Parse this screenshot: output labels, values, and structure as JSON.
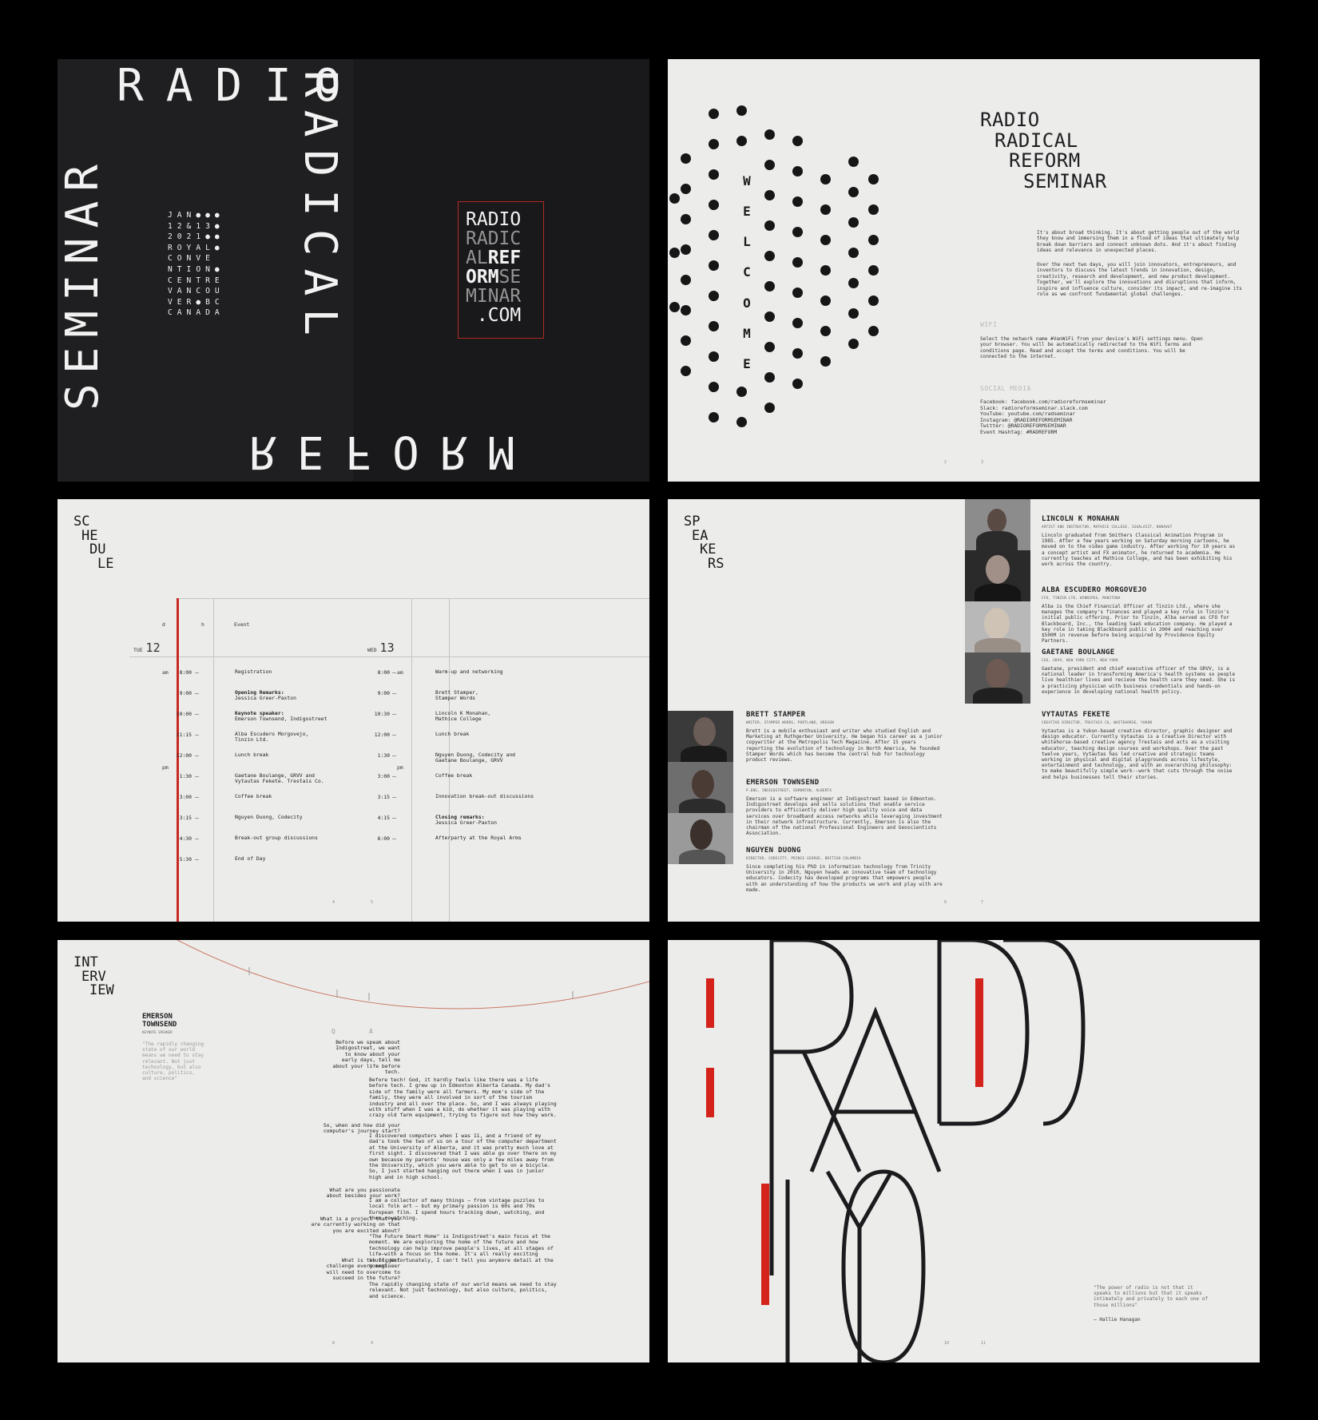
{
  "cover": {
    "radio": "RADIO",
    "radical": "RADICAL",
    "reform": "REFORM",
    "seminar": "SEMINAR",
    "event_grid": "JAN●●●\n12&13●\n2021●●\nROYAL●\nCONVE\nNTION●\nCENTRE\nVANCOU\nVER●BC\nCANADA",
    "url_lines": [
      {
        "text": "RADIO",
        "style": "normal"
      },
      {
        "text": "RADIC",
        "style": "thin"
      },
      {
        "text": "AL",
        "style": "thin",
        "rest": "REF",
        "rest_style": "bold"
      },
      {
        "text": "ORM",
        "style": "bold",
        "rest": "SE",
        "rest_style": "thin"
      },
      {
        "text": "MINAR",
        "style": "thin"
      },
      {
        "text": ".COM",
        "style": "normal"
      }
    ],
    "colors": {
      "background": "#19191b",
      "accent": "#b32a22"
    }
  },
  "welcome": {
    "vertical_word": [
      "W",
      "E",
      "L",
      "C",
      "O",
      "M",
      "E"
    ],
    "title_lines": [
      "RADIO",
      "RADICAL",
      "REFORM",
      "SEMINAR"
    ],
    "intro_1": "It's about broad thinking. It's about getting people out of the world they know and immersing them in a flood of ideas that ultimately help break down barriers and connect unknown dots. And it's about finding ideas and relevance in unexpected places.",
    "intro_2": "Over the next two days, you will join innovators, entrepreneurs, and inventors to discuss the latest trends in innovation, design, creativity, research and development, and new product development. Together, we'll explore the innovations and disruptions that inform, inspire and influence culture, consider its impact, and re-imagine its role as we confront fundamental global challenges.",
    "wifi_label": "WIFI",
    "wifi_text": "Select the network name #VanWiFi from your device's WiFi settings menu. Open your browser. You will be automatically redirected to the WiFi terms and conditions page. Read and accept the terms and conditions. You will be connected to the internet.",
    "social_label": "SOCIAL MEDIA",
    "social_text": "Facebook: facebook.com/radioreformseminar\nSlack: radioreformseminar.slack.com\nYouTube: youtube.com/radseminar\nInstagram: @RADIOREFORMSEMINAR\nTwitter: @RADIOREFORMSEMINAR\nEvent Hashtag: #RADREFORM",
    "page_left": "2",
    "page_right": "3"
  },
  "schedule": {
    "heading": [
      "SC",
      "HE",
      "DU",
      "LE"
    ],
    "col_d": "d",
    "col_h": "h",
    "col_event": "Event",
    "tue_label": "TUE",
    "tue_num": "12",
    "wed_label": "WED",
    "wed_num": "13",
    "am": "am",
    "pm": "pm",
    "day1": [
      {
        "time": "8:00",
        "event": "Registration"
      },
      {
        "time": "9:00",
        "event": "Opening Remarks:",
        "event2": "Jessica Greer-Paxton",
        "bold": true
      },
      {
        "time": "10:00",
        "event": "Keynote speaker:",
        "event2": "Emerson Townsend, Indigostreet",
        "bold": true
      },
      {
        "time": "11:15",
        "event": "Alba Escudero Morgovejo,",
        "event2": "Tinzin Ltd."
      },
      {
        "time": "12:00",
        "event": "Lunch break"
      },
      {
        "time": "1:30",
        "event": "Gaetane Boulange, GRVV and",
        "event2": "Vytautas Fekete. Trestais Co."
      },
      {
        "time": "3:00",
        "event": "Coffee break"
      },
      {
        "time": "3:15",
        "event": "Nguyen Duong, Codecity"
      },
      {
        "time": "4:30",
        "event": "Break-out group discussions"
      },
      {
        "time": "5:30",
        "event": "End of Day"
      }
    ],
    "day2": [
      {
        "time": "8:00",
        "event": "Warm-up and networking"
      },
      {
        "time": "9:00",
        "event": "Brett Stamper,",
        "event2": "Stamper Words"
      },
      {
        "time": "10:30",
        "event": "Lincoln K Monahan,",
        "event2": "Mathice College"
      },
      {
        "time": "12:00",
        "event": "Lunch break"
      },
      {
        "time": "1:30",
        "event": "Nguyen Duong, Codecity and",
        "event2": "Gaetane Boulange, GRVV"
      },
      {
        "time": "3:00",
        "event": "Coffee break"
      },
      {
        "time": "3:15",
        "event": "Innovation break-out discussions"
      },
      {
        "time": "4:15",
        "event": "Closing remarks:",
        "event2": "Jessica Greer-Paxton",
        "bold": true
      },
      {
        "time": "6:00",
        "event": "Afterparty at the Royal Arms"
      }
    ],
    "page_left": "4",
    "page_right": "5",
    "accent": "#c8281f"
  },
  "speakers": {
    "heading": [
      "SP",
      "EA",
      "KE",
      "RS"
    ],
    "right": [
      {
        "name": "LINCOLN K MONAHAN",
        "role": "ARTIST AND INSTRUCTOR, MATHICE COLLEGE, IGOALAIIT, NUNAVUT",
        "bio": "Lincoln graduated from Smithers Classical Animation Program in 1985. After a few years working on Saturday morning cartoons, he moved on to the video game industry. After working for 10 years as a concept artist and FX animator, he returned to academia. He currently teaches at Mathice College, and has been exhibiting his work across the country."
      },
      {
        "name": "ALBA ESCUDERO MORGOVEJO",
        "role": "CFO, TINZIN LTD, WINNIPEG, MANITOBA",
        "bio": "Alba is the Chief Financial Officer at Tinzin Ltd., where she manages the company's finances and played a key role in Tinzin's initial public offering. Prior to Tinzin, Alba served as CFO for Blackboard, Inc., the leading SaaS education company. He played a key role in taking Blackboard public in 2004 and reaching over $500M in revenue before being acquired by Providence Equity Partners."
      },
      {
        "name": "GAETANE BOULANGE",
        "role": "CEO, GRVV, NEW YORK CITY, NEW YORK",
        "bio": "Gaetane, president and chief executive officer of the GRVV, is a national leader in transforming America's health systems so people live healthier lives and recieve the health care they need. She is a practicing physician with business credentials and hands-on experience in developing national health policy."
      },
      {
        "name": "VYTAUTAS FEKETE",
        "role": "CREATIVE DIRECTOR, TRESTAIS CO, WHITEHORSE, YUKON",
        "bio": "Vytautas is a Yukon-based creative director, graphic designer and design educator. Currently Vytautas is a Creative Director with whitehorse-based creative agency Trestais and acts as a visiting educator, teaching design courses and workshops. Over the past twelve years, Vytautas has led creative and strategic teams working in physical and digital playgrounds across lifestyle, entertainment and technology, and with an overarching philosophy: to make beautifully simple work--work that cuts through the noise and helps businesses tell their stories."
      }
    ],
    "left": [
      {
        "name": "BRETT STAMPER",
        "role": "WRITER, STAMPER WORDS, PORTLAND, OREGON",
        "bio": "Brett is a mobile enthusiast and writer who studied English and Marketing at Ruthgerber University. He began his career as a junior copywriter at the Metropolis Tech Magazine. After 15 years reporting the evolution of technology in North America, he founded Stamper Words which has become the central hub for technology product reviews."
      },
      {
        "name": "EMERSON TOWNSEND",
        "role": "P.ENG, INDIGOSTREET, EDMONTON, ALBERTA",
        "bio": "Emerson is a software engineer at Indigostreet based in Edmonton. Indigostreet develops and sells solutions that enable service providers to efficiently deliver high quality voice and data services over broadband access networks while leveraging investment in their network infrastructure. Currently, Emerson is also the chairman of the national Professional Engineers and Geoscientists Association."
      },
      {
        "name": "NGUYEN DUONG",
        "role": "DIRECTOR, CODECITY, PRINCE GEORGE, BRITISH COLUMBIA",
        "bio": "Since completing his PhD in information technology from Trinity University in 2010, Nguyen heads an innovative team of technology educators. Codecity has developed programs that empowers people with an understanding of how the products we work and play with are made."
      }
    ],
    "page_left": "6",
    "page_right": "7"
  },
  "interview": {
    "heading": [
      "INT",
      "ERV",
      "IEW"
    ],
    "name_1": "EMERSON",
    "name_2": "TOWNSEND",
    "role": "KEYNOTE SPEAKER",
    "pull_quote": "\"The rapidly changing state of our world means we need to stay relevant. Not just technology, but also culture, politics, and science\"",
    "q_label": "Q",
    "a_label": "A",
    "questions": [
      "Before we speak about Indigostreet, we want to know about your early days, tell me about your life before tech.",
      "So, when and how did your computer's journey start?",
      "What are you passionate about besides your work?",
      "What is a project that you are currently working on that you are excited about?",
      "What is the biggest challenge every engineer will need to overcome to succeed in the future?"
    ],
    "answers": [
      "Before tech! God, it hardly feels like there was a life before tech. I grew up in Edmonton Alberta Canada. My dad's side of the family were all farmers. My mom's side of the family, they were all involved in sort of the tourism industry and all over the place. So, and I was always playing with stuff when I was a kid, do whether it was playing with crazy old farm equipment, trying to figure out how they work.",
      "I discovered computers when I was 11, and a friend of my dad's took the two of us on a tour of the computer department at the University of Alberta, and it was pretty much love at first sight. I discovered that I was able go over there on my own because my parents' house was only a few miles away from the University, which you were able to get to on a bicycle. So, I just started hanging out there when I was in junior high and in high school.",
      "I am a collector of many things – from vintage puzzles to local folk art – but my primary passion is 60s and 70s European film. I spend hours tracking down, watching, and then rewatching.",
      "\"The Future Smart Home\" is Indigostreet's main focus at the moment. We are exploring the home of the future and how technology can help improve people's lives, at all stages of life—with a focus on the home. It's all really exciting stuff. Unfortunately, I can't tell you anymore detail at the moment.",
      "The rapidly changing state of our world means we need to stay relevant. Not just technology, but also culture, politics, and science."
    ],
    "page_left": "8",
    "page_right": "9"
  },
  "poster": {
    "quote": "\"The power of radio is not that it speaks to millions but that it speaks intimately and privately to each one of those millions\"",
    "attribution": "— Hallie Hanagan",
    "page_left": "10",
    "page_right": "11",
    "accent": "#d3231b"
  }
}
